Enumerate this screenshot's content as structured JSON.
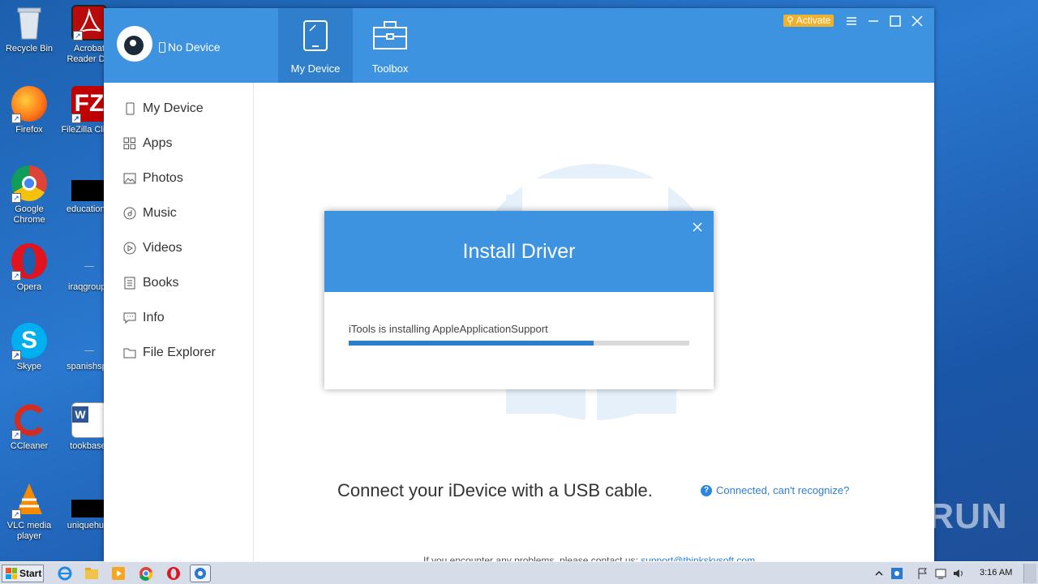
{
  "desktop": {
    "icons": [
      {
        "label": "Recycle Bin",
        "icon": "recycle-bin-icon"
      },
      {
        "label": "Acrobat Reader DC",
        "icon": "acrobat-icon"
      },
      {
        "label": "Firefox",
        "icon": "firefox-icon"
      },
      {
        "label": "FileZilla Client",
        "icon": "filezilla-icon"
      },
      {
        "label": "Google Chrome",
        "icon": "chrome-icon"
      },
      {
        "label": "educational",
        "icon": "file-icon"
      },
      {
        "label": "Opera",
        "icon": "opera-icon"
      },
      {
        "label": "iraqgroups",
        "icon": "file-icon"
      },
      {
        "label": "Skype",
        "icon": "skype-icon"
      },
      {
        "label": "spanishspe",
        "icon": "file-icon"
      },
      {
        "label": "CCleaner",
        "icon": "ccleaner-icon"
      },
      {
        "label": "tookbase.",
        "icon": "word-doc-icon"
      },
      {
        "label": "VLC media player",
        "icon": "vlc-icon"
      },
      {
        "label": "uniquehum",
        "icon": "file-icon"
      }
    ]
  },
  "app": {
    "device_status": "No Device",
    "tabs": [
      {
        "label": "My Device",
        "icon": "phone-icon",
        "active": true
      },
      {
        "label": "Toolbox",
        "icon": "toolbox-icon",
        "active": false
      }
    ],
    "activate_label": "Activate",
    "sidebar": [
      {
        "label": "My Device",
        "icon": "phone-icon"
      },
      {
        "label": "Apps",
        "icon": "apps-grid-icon"
      },
      {
        "label": "Photos",
        "icon": "photo-icon"
      },
      {
        "label": "Music",
        "icon": "music-icon"
      },
      {
        "label": "Videos",
        "icon": "play-icon"
      },
      {
        "label": "Books",
        "icon": "book-icon"
      },
      {
        "label": "Info",
        "icon": "chat-icon"
      },
      {
        "label": "File Explorer",
        "icon": "folder-icon"
      }
    ],
    "main": {
      "connect_text": "Connect your iDevice with a USB cable.",
      "help_link": "Connected, can't recognize?",
      "footer_text": "If you encounter any problems, please contact us:",
      "footer_email": "support@thinkskysoft.com"
    },
    "modal": {
      "title": "Install Driver",
      "message": "iTools is installing AppleApplicationSupport",
      "progress": 0.72
    }
  },
  "taskbar": {
    "start_label": "Start",
    "clock": "3:16 AM"
  },
  "watermark": {
    "text": "ANY RUN"
  },
  "colors": {
    "accent": "#3d93e0",
    "progress": "#2c7fd0",
    "activate": "#f0b22e"
  }
}
